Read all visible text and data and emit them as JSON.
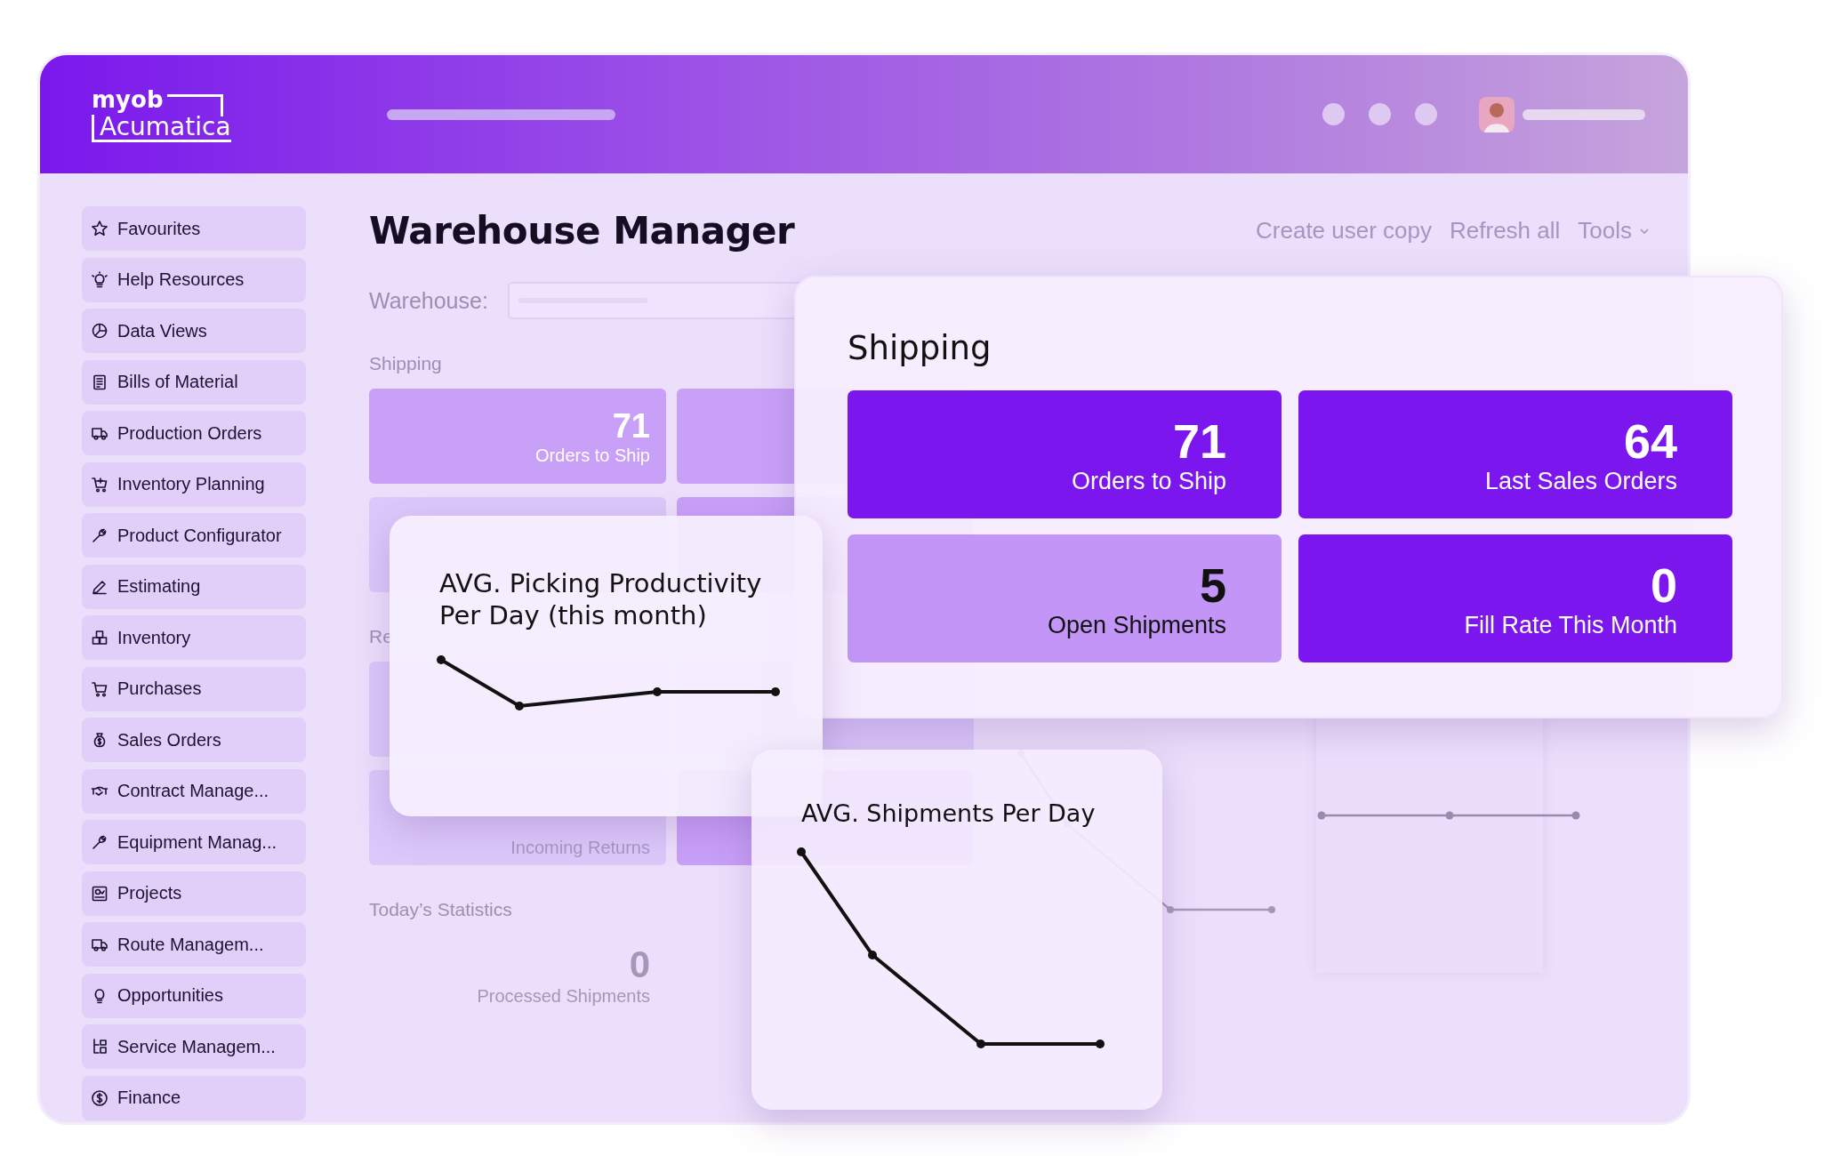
{
  "header": {
    "logo": {
      "line_1": "myob",
      "line_2": "Acumatica"
    }
  },
  "sidebar": {
    "items": [
      {
        "label": "Favourites"
      },
      {
        "label": "Help Resources"
      },
      {
        "label": "Data Views"
      },
      {
        "label": "Bills of Material"
      },
      {
        "label": "Production Orders"
      },
      {
        "label": "Inventory Planning"
      },
      {
        "label": "Product Configurator"
      },
      {
        "label": "Estimating"
      },
      {
        "label": "Inventory"
      },
      {
        "label": "Purchases"
      },
      {
        "label": "Sales Orders"
      },
      {
        "label": "Contract Manage..."
      },
      {
        "label": "Equipment Manag..."
      },
      {
        "label": "Projects"
      },
      {
        "label": "Route Managem..."
      },
      {
        "label": "Opportunities"
      },
      {
        "label": "Service Managem..."
      },
      {
        "label": "Finance"
      }
    ]
  },
  "page": {
    "title": "Warehouse Manager",
    "actions": [
      {
        "label": "Create user copy",
        "kind": "link"
      },
      {
        "label": "Refresh all",
        "kind": "link"
      },
      {
        "label": "Tools",
        "kind": "menu"
      }
    ]
  },
  "warehouse_field": {
    "label": "Warehouse:"
  },
  "shipping_section": {
    "label": "Shipping",
    "tiles": [
      {
        "color": "#c8a0f7",
        "value": "71",
        "label": "Orders to Ship"
      },
      {
        "color": "#c8a0f7"
      },
      {
        "color": "#dcc8fa"
      },
      {
        "color": "#c8a0f7"
      }
    ]
  },
  "receiving_section": {
    "label": "Re",
    "tiles": [
      {
        "color": "#dcc8fa"
      },
      {
        "color": "#dcc8fa"
      },
      {
        "color": "#dcc8fa",
        "label": "Incoming Returns"
      },
      {
        "color": "#c8a0f7"
      }
    ]
  },
  "todays_statistics": {
    "label": "Today’s Statistics",
    "stats": [
      {
        "value": "0",
        "label": "Processed Shipments"
      }
    ]
  },
  "shipping_card": {
    "title": "Shipping",
    "tiles": [
      {
        "color": "#7b16ee",
        "value": "71",
        "label": "Orders to Ship"
      },
      {
        "color": "#7b16ee",
        "value": "64",
        "label": "Last Sales Orders"
      },
      {
        "color": "#c295f7",
        "value": "5",
        "label": "Open Shipments"
      },
      {
        "color": "#7b16ee",
        "value": "0",
        "label": "Fill Rate This Month"
      }
    ]
  },
  "picking_card": {
    "title": "AVG. Picking Productivity Per Day (this month)"
  },
  "shipments_card": {
    "title": "AVG. Shipments Per Day"
  }
}
